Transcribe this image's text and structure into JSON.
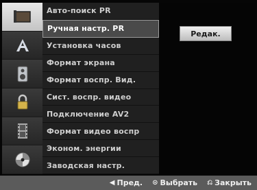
{
  "menu": {
    "items": [
      {
        "label": "Авто-поиск PR"
      },
      {
        "label": "Ручная настр. PR"
      },
      {
        "label": "Установка часов"
      },
      {
        "label": "Формат экрана"
      },
      {
        "label": "Формат воспр. Вид."
      },
      {
        "label": "Сист. воспр. видео"
      },
      {
        "label": "Подключение AV2"
      },
      {
        "label": "Формат видео воспр"
      },
      {
        "label": "Эконом. энергии"
      },
      {
        "label": "Заводская настр."
      }
    ],
    "selected_index": 1
  },
  "sidebar": {
    "icons": [
      {
        "name": "screen-icon",
        "active": true
      },
      {
        "name": "letter-a-icon",
        "active": false
      },
      {
        "name": "speaker-icon",
        "active": false
      },
      {
        "name": "lock-icon",
        "active": false
      },
      {
        "name": "film-icon",
        "active": false
      },
      {
        "name": "disc-icon",
        "active": false
      }
    ]
  },
  "panel": {
    "edit_label": "Редак."
  },
  "footer": {
    "prev_glyph": "◀",
    "prev_label": "Пред.",
    "select_glyph": "⊙",
    "select_label": "Выбрать",
    "close_glyph": "⎌",
    "close_label": "Закрыть"
  },
  "colors": {
    "background": "#060606",
    "menu_bg": "#202020",
    "selected_bg": "#4a4a4a",
    "footer_bg": "#5b5b5b"
  }
}
